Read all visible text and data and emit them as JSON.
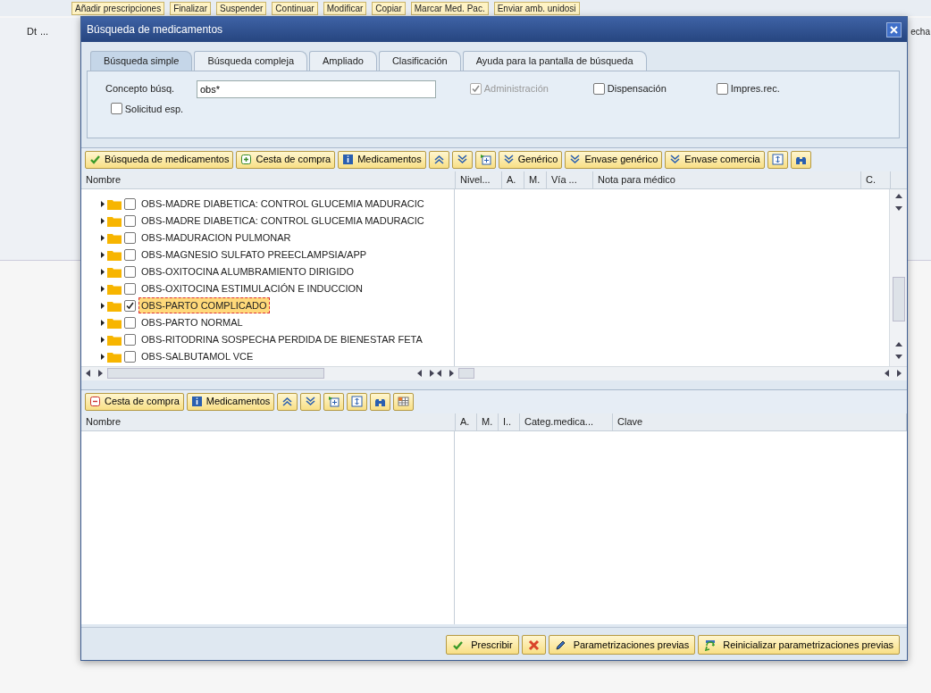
{
  "background": {
    "toolbar": [
      "Añadir prescripciones",
      "Finalizar",
      "Suspender",
      "Continuar",
      "Modificar",
      "Copiar",
      "Marcar Med. Pac.",
      "Enviar amb. unidosi"
    ],
    "left_texts": [
      "Dt",
      "..."
    ],
    "right_text": "echa"
  },
  "dialog": {
    "title": "Búsqueda de medicamentos"
  },
  "tabs": [
    {
      "label": "Búsqueda simple",
      "selected": true
    },
    {
      "label": "Búsqueda compleja",
      "selected": false
    },
    {
      "label": "Ampliado",
      "selected": false
    },
    {
      "label": "Clasificación",
      "selected": false
    },
    {
      "label": "Ayuda para la pantalla de búsqueda",
      "selected": false
    }
  ],
  "search_form": {
    "concept_label": "Concepto búsq.",
    "concept_value": "obs*",
    "checkboxes": [
      {
        "label": "Administración",
        "checked": true,
        "disabled": true
      },
      {
        "label": "Dispensación",
        "checked": false,
        "disabled": false
      },
      {
        "label": "Impres.rec.",
        "checked": false,
        "disabled": false
      },
      {
        "label": "Solicitud esp.",
        "checked": false,
        "disabled": false
      }
    ]
  },
  "results_toolbar": [
    {
      "kind": "check",
      "label": "Búsqueda de medicamentos"
    },
    {
      "kind": "plus",
      "label": "Cesta de compra"
    },
    {
      "kind": "info",
      "label": "Medicamentos"
    },
    {
      "kind": "up"
    },
    {
      "kind": "down"
    },
    {
      "kind": "expand"
    },
    {
      "kind": "down",
      "label": "Genérico"
    },
    {
      "kind": "down",
      "label": "Envase genérico"
    },
    {
      "kind": "down",
      "label": "Envase comercia"
    },
    {
      "kind": "height"
    },
    {
      "kind": "binoculars"
    }
  ],
  "results_table": {
    "columns": [
      "Nombre",
      "Nivel...",
      "A.",
      "M.",
      "Vía ...",
      "Nota para médico",
      "C."
    ],
    "rows": [
      {
        "label": "OBS-MADRE DIABETICA: CONTROL GLUCEMIA MADURACIC",
        "checked": false,
        "selected": false
      },
      {
        "label": "OBS-MADRE DIABETICA: CONTROL GLUCEMIA MADURACIC",
        "checked": false,
        "selected": false
      },
      {
        "label": "OBS-MADURACION PULMONAR",
        "checked": false,
        "selected": false
      },
      {
        "label": "OBS-MAGNESIO SULFATO PREECLAMPSIA/APP",
        "checked": false,
        "selected": false
      },
      {
        "label": "OBS-OXITOCINA ALUMBRAMIENTO DIRIGIDO",
        "checked": false,
        "selected": false
      },
      {
        "label": "OBS-OXITOCINA ESTIMULACIÓN E INDUCCION",
        "checked": false,
        "selected": false
      },
      {
        "label": "OBS-PARTO COMPLICADO",
        "checked": true,
        "selected": true
      },
      {
        "label": "OBS-PARTO NORMAL",
        "checked": false,
        "selected": false
      },
      {
        "label": "OBS-RITODRINA SOSPECHA PERDIDA DE BIENESTAR FETA",
        "checked": false,
        "selected": false
      },
      {
        "label": "OBS-SALBUTAMOL VCE",
        "checked": false,
        "selected": false
      }
    ]
  },
  "basket_toolbar": [
    {
      "kind": "minus",
      "label": "Cesta de compra"
    },
    {
      "kind": "info",
      "label": "Medicamentos"
    },
    {
      "kind": "up"
    },
    {
      "kind": "down"
    },
    {
      "kind": "expand"
    },
    {
      "kind": "height"
    },
    {
      "kind": "binoculars"
    },
    {
      "kind": "grid"
    }
  ],
  "basket_table": {
    "columns": [
      "Nombre",
      "A.",
      "M.",
      "I..",
      "Categ.medica...",
      "Clave"
    ]
  },
  "footer_buttons": [
    {
      "kind": "check",
      "label": "Prescribir"
    },
    {
      "kind": "cross"
    },
    {
      "kind": "pencil",
      "label": "Parametrizaciones previas"
    },
    {
      "kind": "reset",
      "label": "Reinicializar parametrizaciones previas"
    }
  ]
}
